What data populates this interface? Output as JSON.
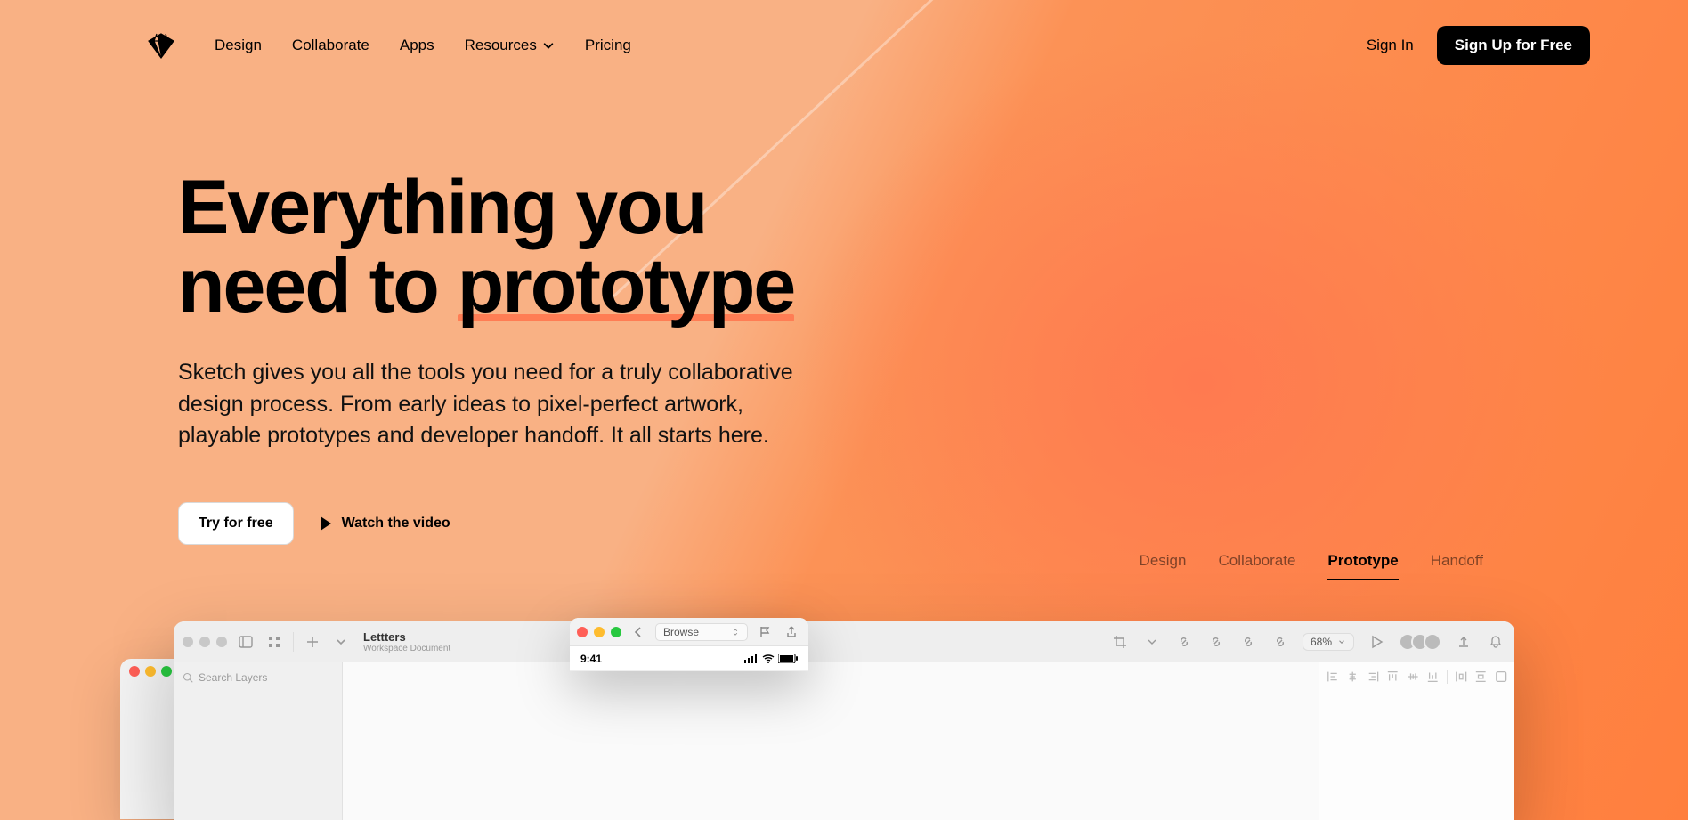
{
  "nav": {
    "items": [
      "Design",
      "Collaborate",
      "Apps",
      "Resources",
      "Pricing"
    ],
    "signin": "Sign In",
    "signup": "Sign Up for Free"
  },
  "hero": {
    "title_line1": "Everything you",
    "title_line2_a": "need to ",
    "title_line2_b": "prototype",
    "lead": "Sketch gives you all the tools you need for a truly collaborative design process. From early ideas to pixel-perfect artwork, playable prototypes and developer handoff. It all starts here.",
    "try": "Try for free",
    "watch": "Watch the video"
  },
  "feature_tabs": {
    "items": [
      "Design",
      "Collaborate",
      "Prototype",
      "Handoff"
    ],
    "active_index": 2
  },
  "app": {
    "doc_name": "Lettters",
    "doc_sub": "Workspace Document",
    "zoom": "68%",
    "search_placeholder": "Search Layers"
  },
  "phone": {
    "browse": "Browse",
    "time": "9:41"
  }
}
